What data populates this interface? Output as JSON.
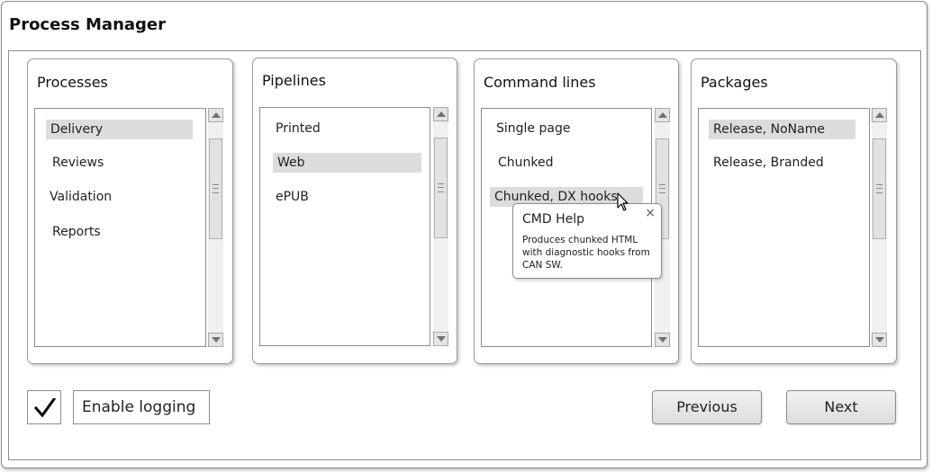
{
  "window": {
    "title": "Process Manager"
  },
  "panels": [
    {
      "title": "Processes",
      "items": [
        "Delivery",
        "Reviews",
        "Validation",
        "Reports"
      ],
      "selected": 0
    },
    {
      "title": "Pipelines",
      "items": [
        "Printed",
        "Web",
        "ePUB"
      ],
      "selected": 1
    },
    {
      "title": "Command lines",
      "items": [
        "Single page",
        "Chunked",
        "Chunked, DX hooks"
      ],
      "selected": 2
    },
    {
      "title": "Packages",
      "items": [
        "Release, NoName",
        "Release, Branded"
      ],
      "selected": 0
    }
  ],
  "tooltip": {
    "title": "CMD Help",
    "close_glyph": "×",
    "body": "Produces chunked HTML with diagnostic hooks from CAN SW."
  },
  "logging": {
    "label": "Enable logging",
    "checked": true
  },
  "buttons": {
    "previous": "Previous",
    "next": "Next"
  },
  "icons": {
    "checkmark": "check-icon",
    "cursor": "mouse-pointer-icon",
    "scroll_up": "arrow-up-icon",
    "scroll_down": "arrow-down-icon"
  }
}
